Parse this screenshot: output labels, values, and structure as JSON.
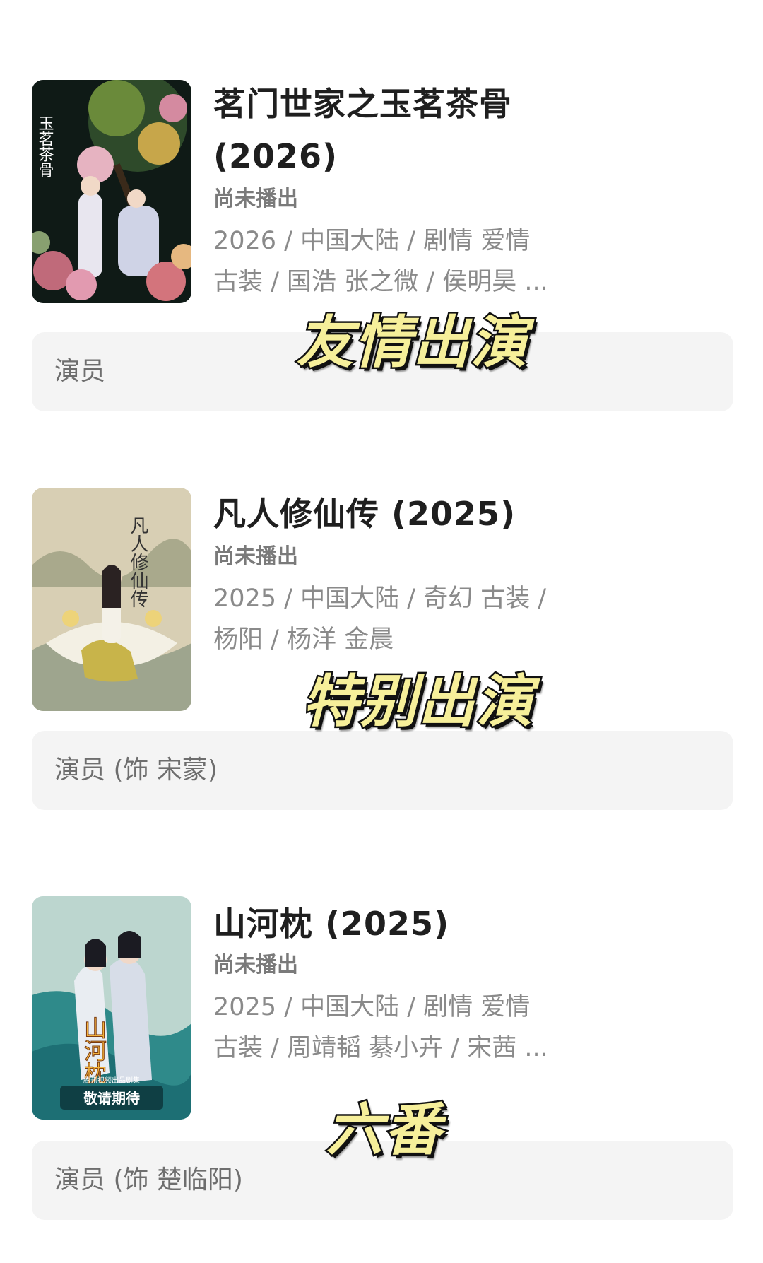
{
  "entries": [
    {
      "title_line1": "茗门世家之玉茗茶骨",
      "title_line2": "(2026)",
      "status": "尚未播出",
      "meta_line1": "2026 / 中国大陆 / 剧情 爱情",
      "meta_line2": "古装 / 国浩 张之微 / 侯明昊 ...",
      "role": "演员",
      "sticker": "友情出演",
      "poster_text": "玉茗茶骨"
    },
    {
      "title_line1": "凡人修仙传 (2025)",
      "status": "尚未播出",
      "meta_line1": "2025 / 中国大陆 / 奇幻 古装 /",
      "meta_line2": "杨阳 / 杨洋 金晨",
      "role": "演员 (饰 宋蒙)",
      "sticker": "特别出演",
      "poster_text": "凡人修仙传"
    },
    {
      "title_line1": "山河枕 (2025)",
      "status": "尚未播出",
      "meta_line1": "2025 / 中国大陆 / 剧情 爱情",
      "meta_line2": "古装 / 周靖韬 綦小卉 / 宋茜 ...",
      "role": "演员 (饰 楚临阳)",
      "sticker": "六番",
      "poster_text": "山河枕",
      "poster_banner_small": "腾讯视频出品剧集",
      "poster_banner": "敬请期待"
    }
  ]
}
